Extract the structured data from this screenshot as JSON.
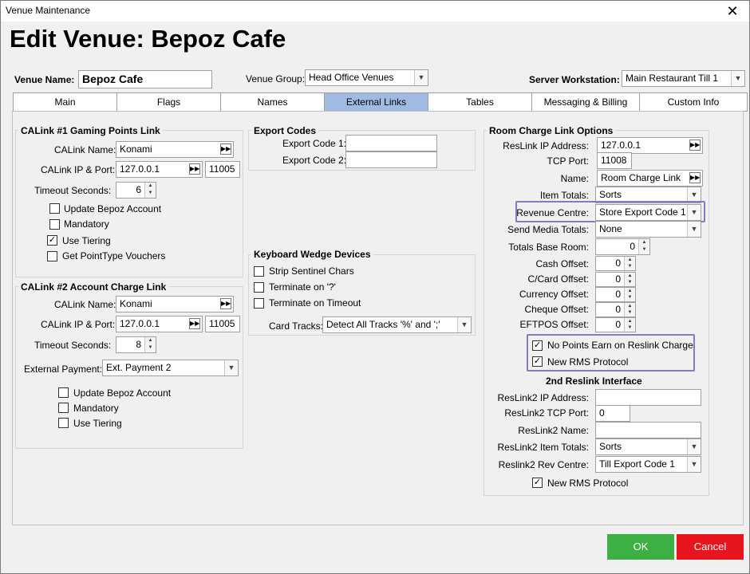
{
  "window": {
    "title": "Venue Maintenance",
    "close": "✕"
  },
  "heading": "Edit Venue: Bepoz Cafe",
  "header": {
    "venue_name_label": "Venue Name:",
    "venue_name_value": "Bepoz Cafe",
    "venue_group_label": "Venue Group:",
    "venue_group_value": "Head Office Venues",
    "server_ws_label": "Server Workstation:",
    "server_ws_value": "Main Restaurant Till 1"
  },
  "tabs": [
    "Main",
    "Flags",
    "Names",
    "External Links",
    "Tables",
    "Messaging & Billing",
    "Custom Info"
  ],
  "active_tab": "External Links",
  "calink1": {
    "title": "CALink #1 Gaming Points Link",
    "name_label": "CALink Name:",
    "name_value": "Konami",
    "ip_label": "CALink IP & Port:",
    "ip_value": "127.0.0.1",
    "port_value": "11005",
    "timeout_label": "Timeout Seconds:",
    "timeout_value": "6",
    "checks": [
      {
        "label": "Update Bepoz Account",
        "checked": false
      },
      {
        "label": "Mandatory",
        "checked": false
      },
      {
        "label": "Use Tiering",
        "checked": true
      },
      {
        "label": "Get PointType Vouchers",
        "checked": false
      }
    ]
  },
  "calink2": {
    "title": "CALink #2 Account Charge Link",
    "name_label": "CALink Name:",
    "name_value": "Konami",
    "ip_label": "CALink IP & Port:",
    "ip_value": "127.0.0.1",
    "port_value": "11005",
    "timeout_label": "Timeout Seconds:",
    "timeout_value": "8",
    "ext_payment_label": "External Payment:",
    "ext_payment_value": "Ext. Payment 2",
    "checks": [
      {
        "label": "Update Bepoz Account",
        "checked": false
      },
      {
        "label": "Mandatory",
        "checked": false
      },
      {
        "label": "Use Tiering",
        "checked": false
      }
    ]
  },
  "export_codes": {
    "title": "Export Codes",
    "code1_label": "Export Code 1:",
    "code1_value": "",
    "code2_label": "Export Code 2:",
    "code2_value": ""
  },
  "keyboard_wedge": {
    "title": "Keyboard Wedge Devices",
    "checks": [
      {
        "label": "Strip Sentinel Chars",
        "checked": false
      },
      {
        "label": "Terminate on '?'",
        "checked": false
      },
      {
        "label": "Terminate on Timeout",
        "checked": false
      }
    ],
    "card_tracks_label": "Card Tracks:",
    "card_tracks_value": "Detect All Tracks '%' and ';'"
  },
  "room_charge": {
    "title": "Room Charge Link Options",
    "reslink_ip_label": "ResLink  IP Address:",
    "reslink_ip_value": "127.0.0.1",
    "tcp_port_label": "TCP Port:",
    "tcp_port_value": "11008",
    "name_label": "Name:",
    "name_value": "Room Charge Link",
    "item_totals_label": "Item Totals:",
    "item_totals_value": "Sorts",
    "revenue_centre_label": "Revenue Centre:",
    "revenue_centre_value": "Store Export Code 1",
    "send_media_label": "Send Media Totals:",
    "send_media_value": "None",
    "totals_base_room_label": "Totals Base Room:",
    "totals_base_room_value": "0",
    "cash_offset_label": "Cash Offset:",
    "cash_offset_value": "0",
    "ccard_offset_label": "C/Card Offset:",
    "ccard_offset_value": "0",
    "currency_offset_label": "Currency Offset:",
    "currency_offset_value": "0",
    "cheque_offset_label": "Cheque Offset:",
    "cheque_offset_value": "0",
    "eftpos_offset_label": "EFTPOS Offset:",
    "eftpos_offset_value": "0",
    "no_points_label": "No Points Earn on Reslink Charge",
    "no_points_checked": true,
    "new_rms_label": "New RMS Protocol",
    "new_rms_checked": true,
    "second_title": "2nd Reslink Interface",
    "rl2_ip_label": "ResLink2  IP Address:",
    "rl2_ip_value": "",
    "rl2_port_label": "ResLink2 TCP Port:",
    "rl2_port_value": "0",
    "rl2_name_label": "ResLink2 Name:",
    "rl2_name_value": "",
    "rl2_item_totals_label": "ResLink2 Item Totals:",
    "rl2_item_totals_value": "Sorts",
    "rl2_rev_centre_label": "Reslink2 Rev Centre:",
    "rl2_rev_centre_value": "Till Export Code 1",
    "rl2_new_rms_label": "New RMS Protocol",
    "rl2_new_rms_checked": true
  },
  "buttons": {
    "ok": "OK",
    "cancel": "Cancel"
  },
  "colors": {
    "ok": "#3cb043",
    "cancel": "#e8141e",
    "highlight": "#7e7ec4",
    "active_tab": "#9fbbe3"
  }
}
